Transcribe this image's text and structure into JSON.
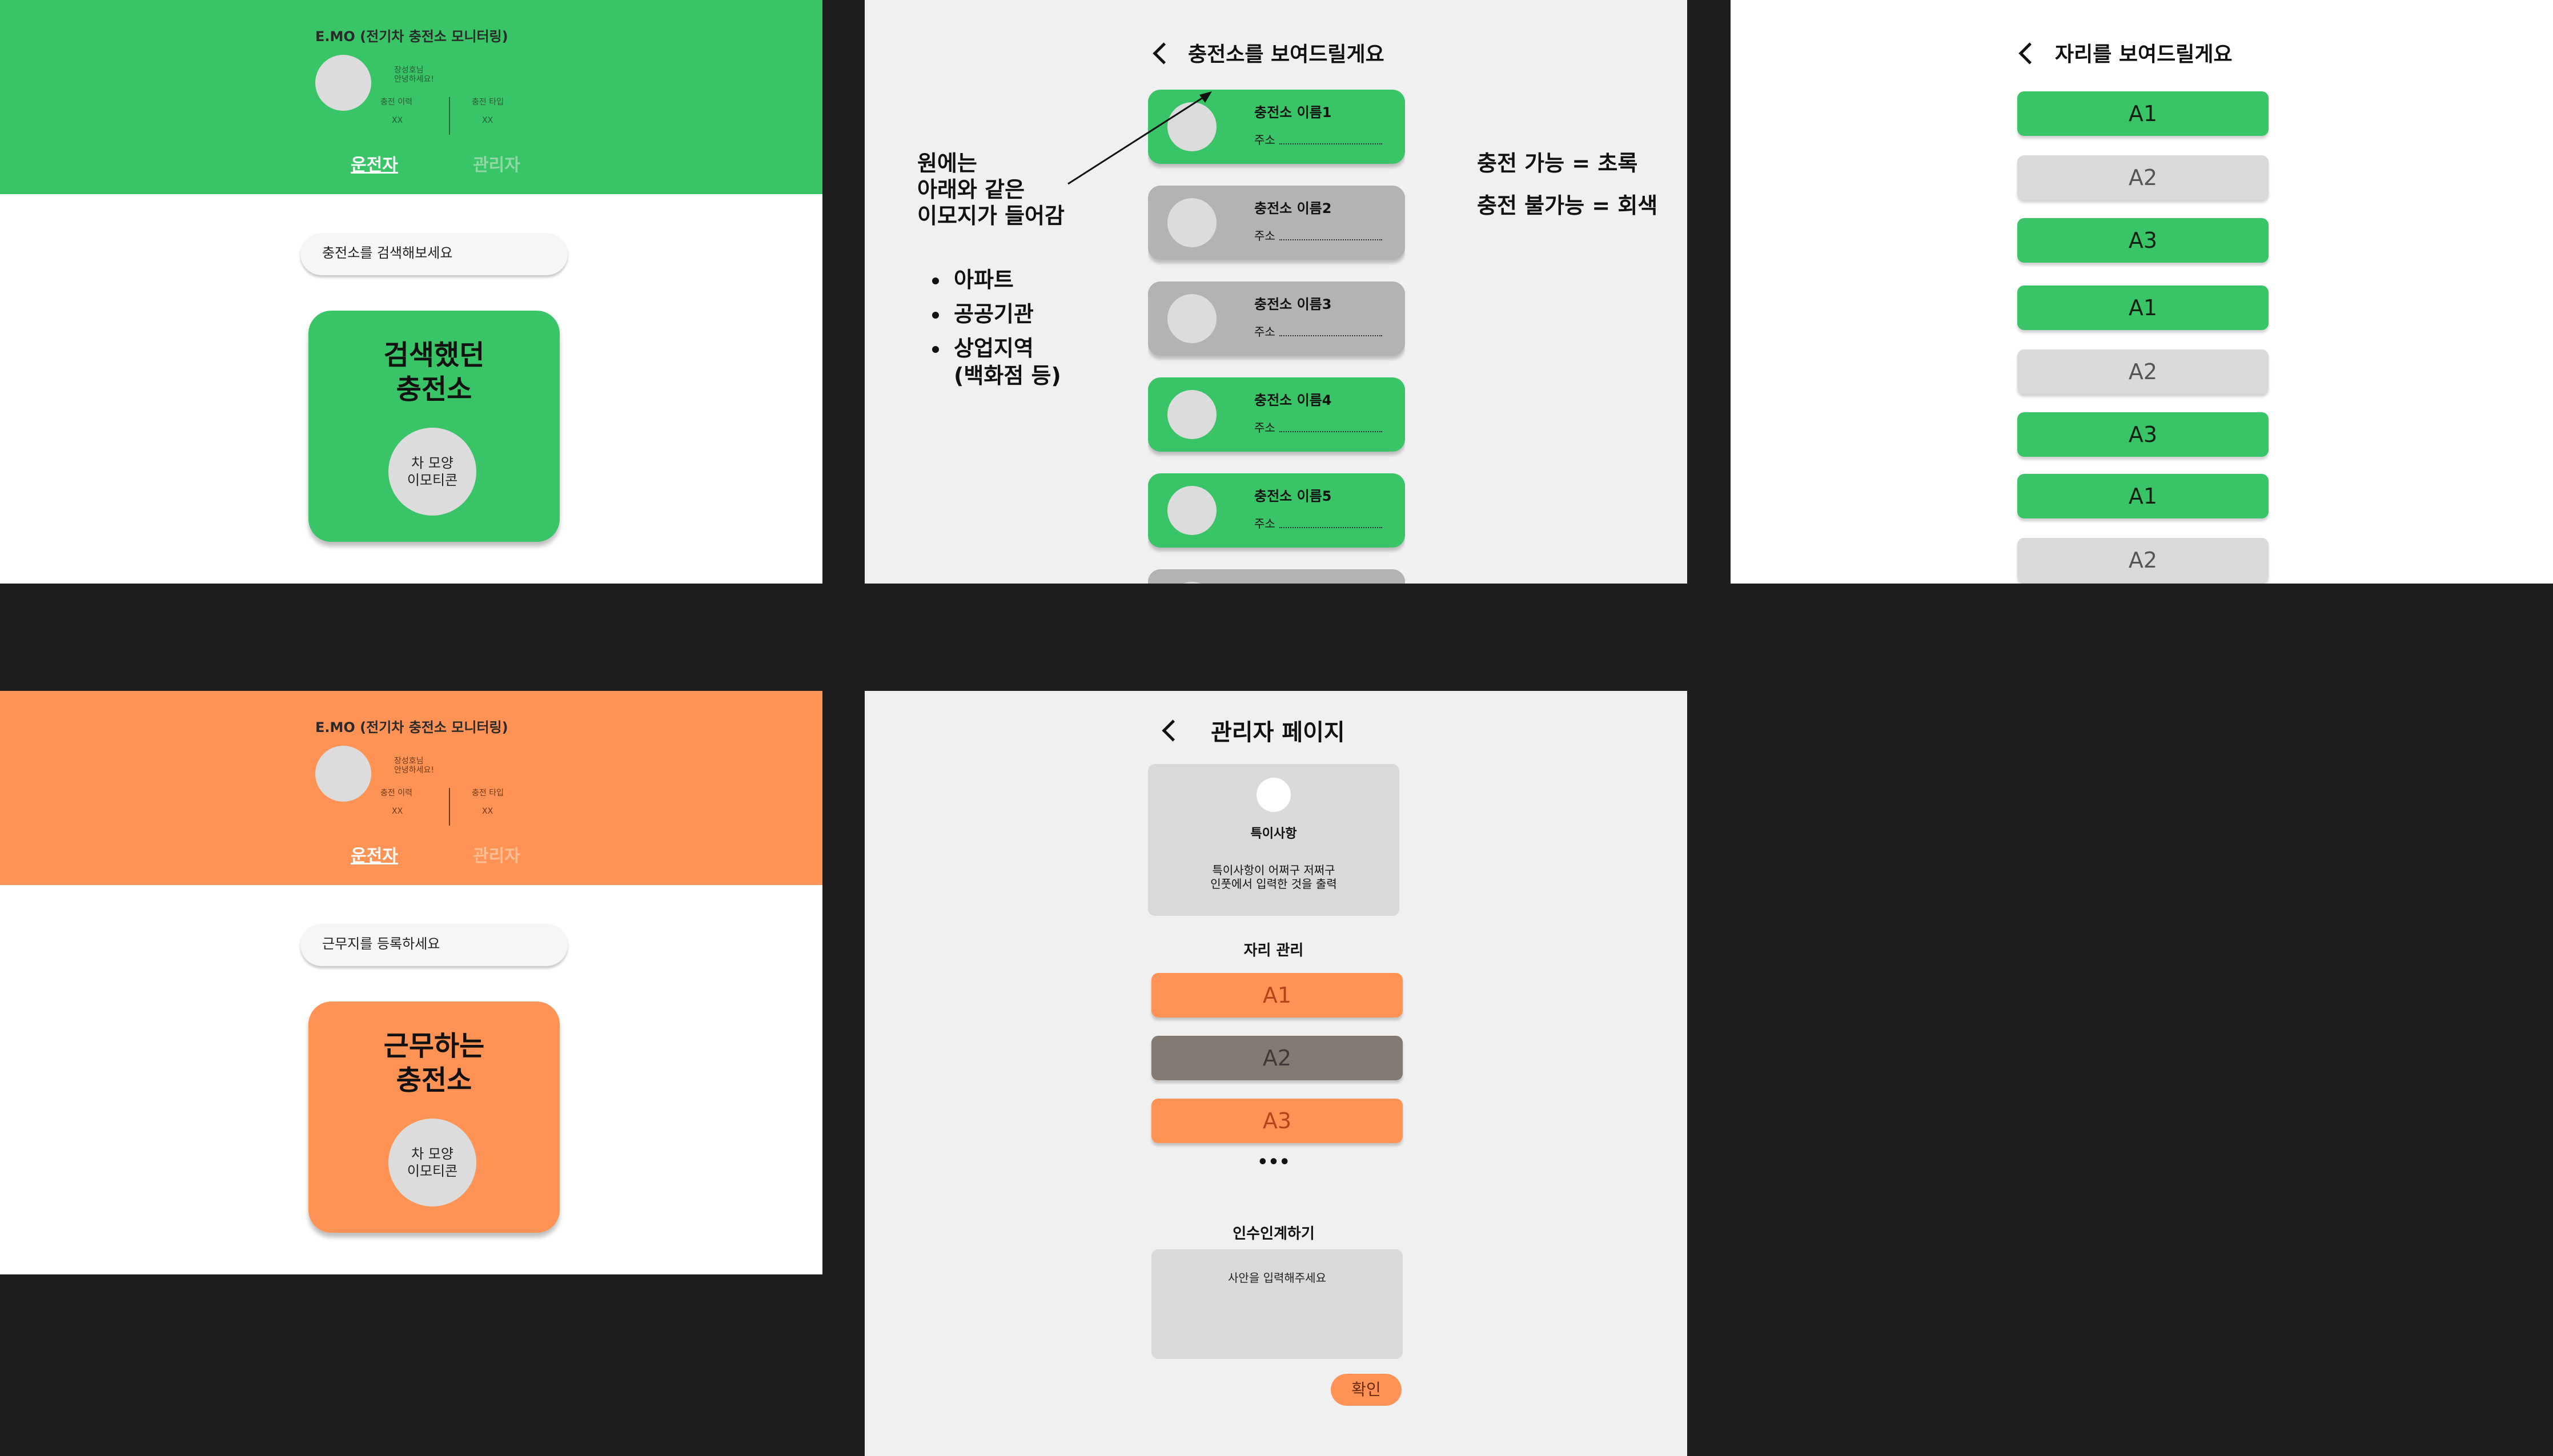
{
  "colors": {
    "green": "#39c468",
    "orange": "#ff9355",
    "gray": "#d9d9d9",
    "dark": "#1e1e1e",
    "panel": "#f0f0f0"
  },
  "driver_home": {
    "app_title": "E.MO (전기차 충전소 모니터링)",
    "greeting_line1": "장성호님",
    "greeting_line2": "안녕하세요!",
    "stat1_label": "충전 이력",
    "stat1_value": "XX",
    "stat2_label": "충전 타입",
    "stat2_value": "XX",
    "tab_driver": "운전자",
    "tab_admin": "관리자",
    "search_placeholder": "충전소를 검색해보세요",
    "card_title_line1": "검색했던",
    "card_title_line2": "충전소",
    "emoji_line1": "차 모양",
    "emoji_line2": "이모티콘"
  },
  "station_list": {
    "title": "충전소를 보여드릴게요",
    "stations": [
      {
        "name": "충전소 이름1",
        "addr": "주소",
        "available": true
      },
      {
        "name": "충전소 이름2",
        "addr": "주소",
        "available": false
      },
      {
        "name": "충전소 이름3",
        "addr": "주소",
        "available": false
      },
      {
        "name": "충전소 이름4",
        "addr": "주소",
        "available": true
      },
      {
        "name": "충전소 이름5",
        "addr": "주소",
        "available": true
      }
    ],
    "note_line1": "원에는",
    "note_line2": "아래와 같은",
    "note_line3": "이모지가 들어감",
    "bullets": [
      "아파트",
      "공공기관",
      "상업지역"
    ],
    "bullet_sub": "(백화점 등)",
    "legend_line1": "충전 가능 = 초록",
    "legend_line2": "충전 불가능 = 회색"
  },
  "slot_list": {
    "title": "자리를 보여드릴게요",
    "slots": [
      {
        "label": "A1",
        "available": true
      },
      {
        "label": "A2",
        "available": false
      },
      {
        "label": "A3",
        "available": true
      },
      {
        "label": "A1",
        "available": true
      },
      {
        "label": "A2",
        "available": false
      },
      {
        "label": "A3",
        "available": true
      },
      {
        "label": "A1",
        "available": true
      },
      {
        "label": "A2",
        "available": false
      }
    ]
  },
  "admin_home": {
    "app_title": "E.MO (전기차 충전소 모니터링)",
    "greeting_line1": "장성호님",
    "greeting_line2": "안녕하세요!",
    "stat1_label": "충전 이력",
    "stat1_value": "XX",
    "stat2_label": "충전 타입",
    "stat2_value": "XX",
    "tab_driver": "운전자",
    "tab_admin": "관리자",
    "search_placeholder": "근무지를 등록하세요",
    "card_title_line1": "근무하는",
    "card_title_line2": "충전소",
    "emoji_line1": "차 모양",
    "emoji_line2": "이모티콘"
  },
  "admin_page": {
    "title": "관리자 페이지",
    "notice_title": "특이사항",
    "notice_line1": "특이사항이 어쩌구 저쩌구",
    "notice_line2": "인풋에서 입력한 것을 출력",
    "slot_section": "자리 관리",
    "slots": [
      {
        "label": "A1",
        "state": "orange"
      },
      {
        "label": "A2",
        "state": "dark"
      },
      {
        "label": "A3",
        "state": "orange"
      }
    ],
    "more": "•••",
    "handover_title": "인수인계하기",
    "handover_placeholder": "사안을 입력해주세요",
    "confirm": "확인"
  }
}
